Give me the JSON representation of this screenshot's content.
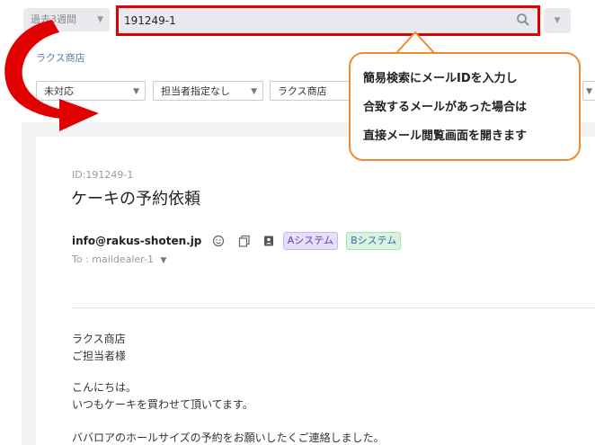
{
  "topbar": {
    "period_label": "過去3週間",
    "search_value": "191249-1",
    "colors": {
      "highlight": "#e00000",
      "bar_bg": "#e9eaed"
    }
  },
  "breadcrumb": "ラクス商店",
  "filters": {
    "first": "未対応",
    "assignee": "担当者指定なし",
    "shop": "ラクス商店"
  },
  "mail": {
    "id": "ID:191249-1",
    "subject": "ケーキの予約依頼",
    "from": "info@rakus-shoten.jp",
    "tags": [
      "Aシステム",
      "Bシステム"
    ],
    "to": "To : maildealer-1",
    "body": [
      "ラクス商店",
      "ご担当者様",
      "こんにちは。",
      "いつもケーキを買わせて頂いてます。",
      "ババロアのホールサイズの予約をお願いしたくご連絡しました。"
    ]
  },
  "callout": {
    "lines": [
      "簡易検索にメールIDを入力し",
      "合致するメールがあった場合は",
      "直接メール閲覧画面を開きます"
    ],
    "border_color": "#ee8a32",
    "arrow_color": "#e00000"
  }
}
